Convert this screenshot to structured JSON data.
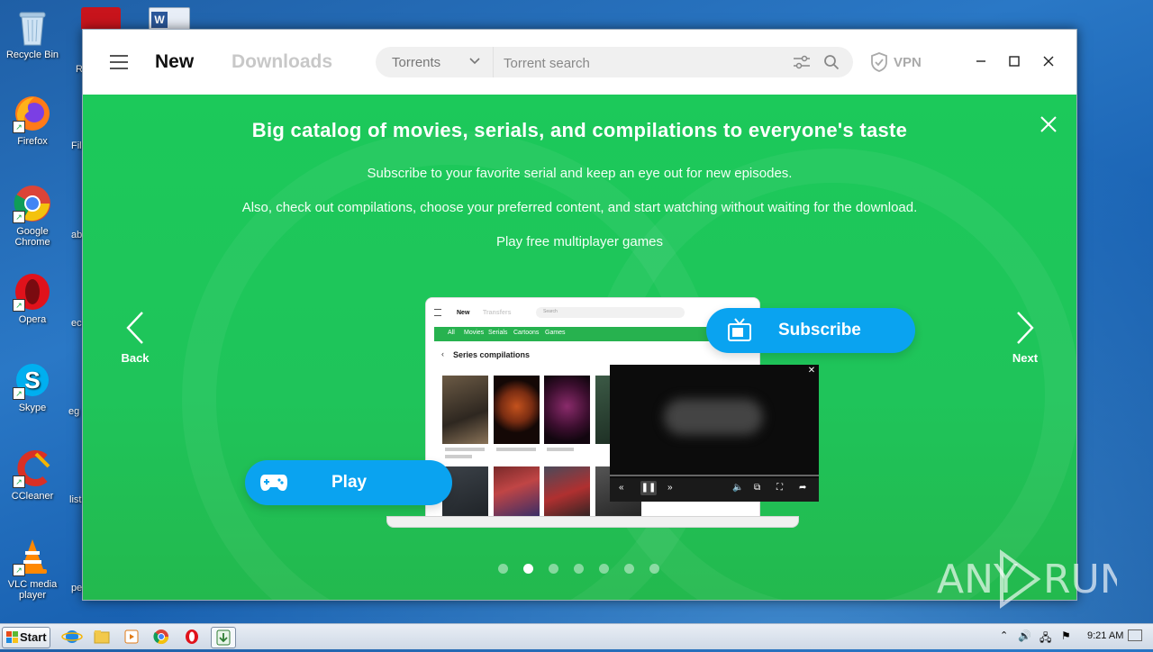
{
  "desktop": {
    "icons": [
      {
        "label": "Recycle Bin",
        "icon": "recycle-bin-icon"
      },
      {
        "label": "Firefox",
        "icon": "firefox-icon"
      },
      {
        "label": "Google Chrome",
        "icon": "chrome-icon"
      },
      {
        "label": "Opera",
        "icon": "opera-icon"
      },
      {
        "label": "Skype",
        "icon": "skype-icon"
      },
      {
        "label": "CCleaner",
        "icon": "ccleaner-icon"
      },
      {
        "label": "VLC media player",
        "icon": "vlc-icon"
      }
    ],
    "peek_labels": [
      "R",
      "Fil",
      "ab",
      "ec",
      "eg",
      "list",
      "pe"
    ]
  },
  "window": {
    "tabs": {
      "new": "New",
      "downloads": "Downloads"
    },
    "search": {
      "category": "Torrents",
      "placeholder": "Torrent search"
    },
    "vpn_label": "VPN"
  },
  "banner": {
    "title": "Big catalog of movies, serials, and compilations to everyone's taste",
    "lines": [
      "Subscribe to your favorite serial and keep an eye out for new episodes.",
      "Also, check out compilations, choose your preferred content, and start watching without waiting for the download.",
      "Play free multiplayer games"
    ],
    "back_label": "Back",
    "next_label": "Next",
    "subscribe_label": "Subscribe",
    "play_label": "Play",
    "dots_total": 7,
    "active_dot": 1,
    "mockup": {
      "tab_new": "New",
      "tab_transfers": "Transfers",
      "search": "Search",
      "categories": [
        "All",
        "Movies",
        "Serials",
        "Cartoons",
        "Games"
      ],
      "section_title": "Series compilations"
    },
    "colors": {
      "green": "#1fc45a",
      "accent_blue": "#0aa3f0"
    }
  },
  "watermark": "ANY RUN",
  "taskbar": {
    "start_label": "Start",
    "clock": "9:21 AM"
  }
}
